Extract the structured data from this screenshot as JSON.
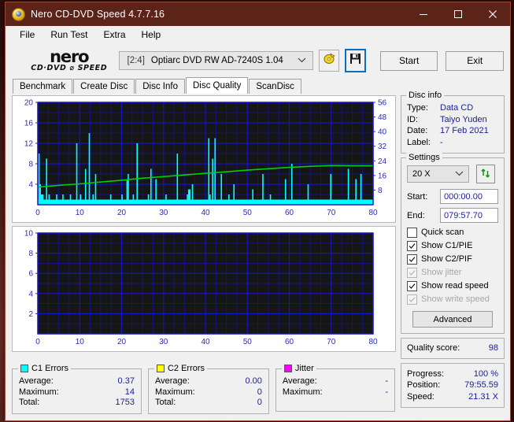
{
  "window": {
    "title": "Nero CD-DVD Speed 4.7.7.16",
    "icon": "nero-disc-icon",
    "controls": {
      "minimize": "minimize-icon",
      "maximize": "maximize-icon",
      "close": "close-icon"
    },
    "titlebar_color": "#5c2318"
  },
  "menu": {
    "items": [
      "File",
      "Run Test",
      "Extra",
      "Help"
    ]
  },
  "toolbar": {
    "logo_main": "nero",
    "logo_sub": "CD·DVD ⌀ SPEED",
    "drive_index": "[2:4]",
    "drive_name": "Optiarc DVD RW AD-7240S 1.04",
    "eject_icon": "eject-disc-icon",
    "save_icon": "save-floppy-icon",
    "start_label": "Start",
    "exit_label": "Exit"
  },
  "tabs": {
    "items": [
      "Benchmark",
      "Create Disc",
      "Disc Info",
      "Disc Quality",
      "ScanDisc"
    ],
    "active": "Disc Quality"
  },
  "disc_info": {
    "legend": "Disc info",
    "rows": [
      {
        "key": "Type:",
        "value": "Data CD"
      },
      {
        "key": "ID:",
        "value": "Taiyo Yuden"
      },
      {
        "key": "Date:",
        "value": "17 Feb 2021"
      },
      {
        "key": "Label:",
        "value": "-"
      }
    ]
  },
  "settings": {
    "legend": "Settings",
    "speed": "20 X",
    "refresh_icon": "refresh-speed-icon",
    "start_label": "Start:",
    "start_value": "000:00.00",
    "end_label": "End:",
    "end_value": "079:57.70",
    "checkboxes": [
      {
        "label": "Quick scan",
        "checked": false,
        "enabled": true
      },
      {
        "label": "Show C1/PIE",
        "checked": true,
        "enabled": true
      },
      {
        "label": "Show C2/PIF",
        "checked": true,
        "enabled": true
      },
      {
        "label": "Show jitter",
        "checked": true,
        "enabled": false
      },
      {
        "label": "Show read speed",
        "checked": true,
        "enabled": true
      },
      {
        "label": "Show write speed",
        "checked": true,
        "enabled": false
      }
    ],
    "advanced_label": "Advanced"
  },
  "quality": {
    "label": "Quality score:",
    "value": "98"
  },
  "progress": {
    "rows": [
      {
        "key": "Progress:",
        "value": "100 %"
      },
      {
        "key": "Position:",
        "value": "79:55.59"
      },
      {
        "key": "Speed:",
        "value": "21.31 X"
      }
    ]
  },
  "stats": {
    "c1": {
      "legend": "C1 Errors",
      "color": "#00ffff",
      "rows": [
        {
          "key": "Average:",
          "value": "0.37"
        },
        {
          "key": "Maximum:",
          "value": "14"
        },
        {
          "key": "Total:",
          "value": "1753"
        }
      ]
    },
    "c2": {
      "legend": "C2 Errors",
      "color": "#ffff00",
      "rows": [
        {
          "key": "Average:",
          "value": "0.00"
        },
        {
          "key": "Maximum:",
          "value": "0"
        },
        {
          "key": "Total:",
          "value": "0"
        }
      ]
    },
    "jitter": {
      "legend": "Jitter",
      "color": "#ff00ff",
      "rows": [
        {
          "key": "Average:",
          "value": "-"
        },
        {
          "key": "Maximum:",
          "value": "-"
        }
      ]
    }
  },
  "chart_data": [
    {
      "type": "bar",
      "name": "c1-errors-chart",
      "title": "",
      "xlabel": "",
      "ylabel": "C1 errors",
      "xlim": [
        0,
        80
      ],
      "ylim": [
        0,
        20
      ],
      "y2lim": [
        0,
        56
      ],
      "y2label": "Read speed (X)",
      "grid": true,
      "xticks": [
        0,
        10,
        20,
        30,
        40,
        50,
        60,
        70,
        80
      ],
      "yticks": [
        4,
        8,
        12,
        16,
        20
      ],
      "y2ticks": [
        8,
        16,
        24,
        32,
        40,
        48,
        56
      ],
      "bar_color": "#00ffff",
      "line_color": "#00d000",
      "background": "#161616",
      "grid_color": "#1414c8",
      "x": [
        0.3,
        0.6,
        0.9,
        1.2,
        1.5,
        1.8,
        2.1,
        2.4,
        2.7,
        3.0,
        3.3,
        3.6,
        3.9,
        4.2,
        4.5,
        4.8,
        5.1,
        5.4,
        5.7,
        6.0,
        6.3,
        6.6,
        6.9,
        7.2,
        7.5,
        7.8,
        8.1,
        8.4,
        8.7,
        9.0,
        9.3,
        9.6,
        9.9,
        10.2,
        10.5,
        10.8,
        11.1,
        11.4,
        11.7,
        12.0,
        12.3,
        12.6,
        12.9,
        13.2,
        13.5,
        13.8,
        14.1,
        14.4,
        14.7,
        15.0,
        15.3,
        15.6,
        15.9,
        16.2,
        16.5,
        16.8,
        17.1,
        17.4,
        17.7,
        18.0,
        18.3,
        18.6,
        18.9,
        19.2,
        19.5,
        19.8,
        20.1,
        20.4,
        20.7,
        21.0,
        21.3,
        21.6,
        21.9,
        22.2,
        22.5,
        22.8,
        23.1,
        23.4,
        23.7,
        24.0,
        24.3,
        24.6,
        24.9,
        25.2,
        25.5,
        25.8,
        26.1,
        26.4,
        26.7,
        27.0,
        27.3,
        27.6,
        27.9,
        28.2,
        28.5,
        28.8,
        29.1,
        29.4,
        29.7,
        30.0,
        30.3,
        30.6,
        30.9,
        31.2,
        31.5,
        31.8,
        32.1,
        32.4,
        32.7,
        33.0,
        33.3,
        33.6,
        33.9,
        34.2,
        34.5,
        34.8,
        35.1,
        35.4,
        35.7,
        36.0,
        36.3,
        36.6,
        36.9,
        37.2,
        37.5,
        37.8,
        38.1,
        38.4,
        38.7,
        39.0,
        39.3,
        39.6,
        39.9,
        40.2,
        40.5,
        40.8,
        41.1,
        41.4,
        41.7,
        42.0,
        42.3,
        42.6,
        42.9,
        43.2,
        43.5,
        43.8,
        44.1,
        44.4,
        44.7,
        45.0,
        45.3,
        45.6,
        45.9,
        46.2,
        46.5,
        46.8,
        47.1,
        47.4,
        47.7,
        48.0,
        48.3,
        48.6,
        48.9,
        49.2,
        49.5,
        49.8,
        50.1,
        50.4,
        50.7,
        51.0,
        51.3,
        51.6,
        51.9,
        52.2,
        52.5,
        52.8,
        53.1,
        53.4,
        53.7,
        54.0,
        54.3,
        54.6,
        54.9,
        55.2,
        55.5,
        55.8,
        56.1,
        56.4,
        56.7,
        57.0,
        57.3,
        57.6,
        57.9,
        58.2,
        58.5,
        58.8,
        59.1,
        59.4,
        59.7,
        60.0,
        60.3,
        60.6,
        60.9,
        61.2,
        61.5,
        61.8,
        62.1,
        62.4,
        62.7,
        63.0,
        63.3,
        63.6,
        63.9,
        64.2,
        64.5,
        64.8,
        65.1,
        65.4,
        65.7,
        66.0,
        66.3,
        66.6,
        66.9,
        67.2,
        67.5,
        67.8,
        68.1,
        68.4,
        68.7,
        69.0,
        69.3,
        69.6,
        69.9,
        70.2,
        70.5,
        70.8,
        71.1,
        71.4,
        71.7,
        72.0,
        72.3,
        72.6,
        72.9,
        73.2,
        73.5,
        73.8,
        74.1,
        74.4,
        74.7,
        75.0,
        75.3,
        75.6,
        75.9,
        76.2,
        76.5,
        76.8,
        77.1,
        77.4,
        77.7,
        78.0,
        78.3,
        78.6,
        78.9,
        79.2,
        79.5,
        79.8
      ],
      "values": [
        10,
        4,
        2,
        2,
        1,
        1,
        9,
        1,
        2,
        1,
        1,
        1,
        1,
        1,
        2,
        1,
        1,
        1,
        1,
        2,
        1,
        1,
        1,
        1,
        1,
        2,
        1,
        1,
        1,
        1,
        12,
        1,
        1,
        2,
        1,
        1,
        1,
        7,
        1,
        1,
        14,
        1,
        1,
        2,
        1,
        6,
        1,
        1,
        1,
        1,
        1,
        1,
        1,
        1,
        1,
        1,
        1,
        2,
        1,
        1,
        1,
        1,
        1,
        1,
        1,
        1,
        2,
        1,
        1,
        1,
        5,
        6,
        1,
        1,
        1,
        2,
        1,
        1,
        12,
        1,
        1,
        1,
        1,
        1,
        1,
        1,
        1,
        2,
        1,
        7,
        1,
        1,
        1,
        5,
        1,
        1,
        1,
        1,
        1,
        1,
        1,
        2,
        1,
        1,
        1,
        1,
        1,
        1,
        1,
        1,
        10,
        1,
        1,
        1,
        1,
        1,
        1,
        1,
        2,
        3,
        3,
        1,
        4,
        1,
        1,
        1,
        1,
        1,
        1,
        1,
        1,
        1,
        1,
        1,
        1,
        13,
        2,
        1,
        9,
        1,
        13,
        1,
        1,
        1,
        1,
        6,
        1,
        1,
        1,
        1,
        1,
        2,
        1,
        1,
        1,
        4,
        1,
        1,
        1,
        1,
        1,
        1,
        1,
        1,
        1,
        1,
        1,
        1,
        1,
        1,
        3,
        1,
        1,
        1,
        1,
        1,
        1,
        1,
        6,
        1,
        1,
        1,
        1,
        1,
        2,
        1,
        1,
        1,
        1,
        1,
        1,
        1,
        1,
        1,
        1,
        1,
        5,
        1,
        1,
        1,
        1,
        8,
        1,
        1,
        1,
        1,
        1,
        1,
        1,
        1,
        1,
        1,
        1,
        1,
        4,
        1,
        1,
        1,
        1,
        1,
        1,
        1,
        1,
        1,
        1,
        1,
        1,
        1,
        1,
        1,
        1,
        1,
        6,
        1,
        1,
        1,
        1,
        1,
        1,
        1,
        1,
        1,
        1,
        1,
        1,
        1,
        7,
        1,
        1,
        1,
        1,
        1,
        5,
        1,
        1,
        1,
        6,
        1,
        1,
        1,
        1,
        1,
        1,
        1,
        1,
        1,
        1,
        1,
        1,
        5,
        1
      ],
      "series": [
        {
          "name": "Read speed",
          "axis": "y2",
          "x": [
            0,
            5,
            10,
            15,
            20,
            25,
            30,
            35,
            40,
            45,
            50,
            55,
            60,
            65,
            70,
            75,
            80
          ],
          "values": [
            9.6,
            10.6,
            11.4,
            12.4,
            13.4,
            14.5,
            15.4,
            16.3,
            17.2,
            18.0,
            18.9,
            19.7,
            20.4,
            21.0,
            21.4,
            21.3,
            21.3
          ]
        }
      ]
    },
    {
      "type": "bar",
      "name": "c2-errors-chart",
      "title": "",
      "xlabel": "",
      "ylabel": "C2 errors",
      "xlim": [
        0,
        80
      ],
      "ylim": [
        0,
        10
      ],
      "grid": true,
      "xticks": [
        0,
        10,
        20,
        30,
        40,
        50,
        60,
        70,
        80
      ],
      "yticks": [
        2,
        4,
        6,
        8,
        10
      ],
      "bar_color": "#ffff00",
      "background": "#161616",
      "grid_color": "#1414c8",
      "x": [],
      "values": []
    }
  ]
}
